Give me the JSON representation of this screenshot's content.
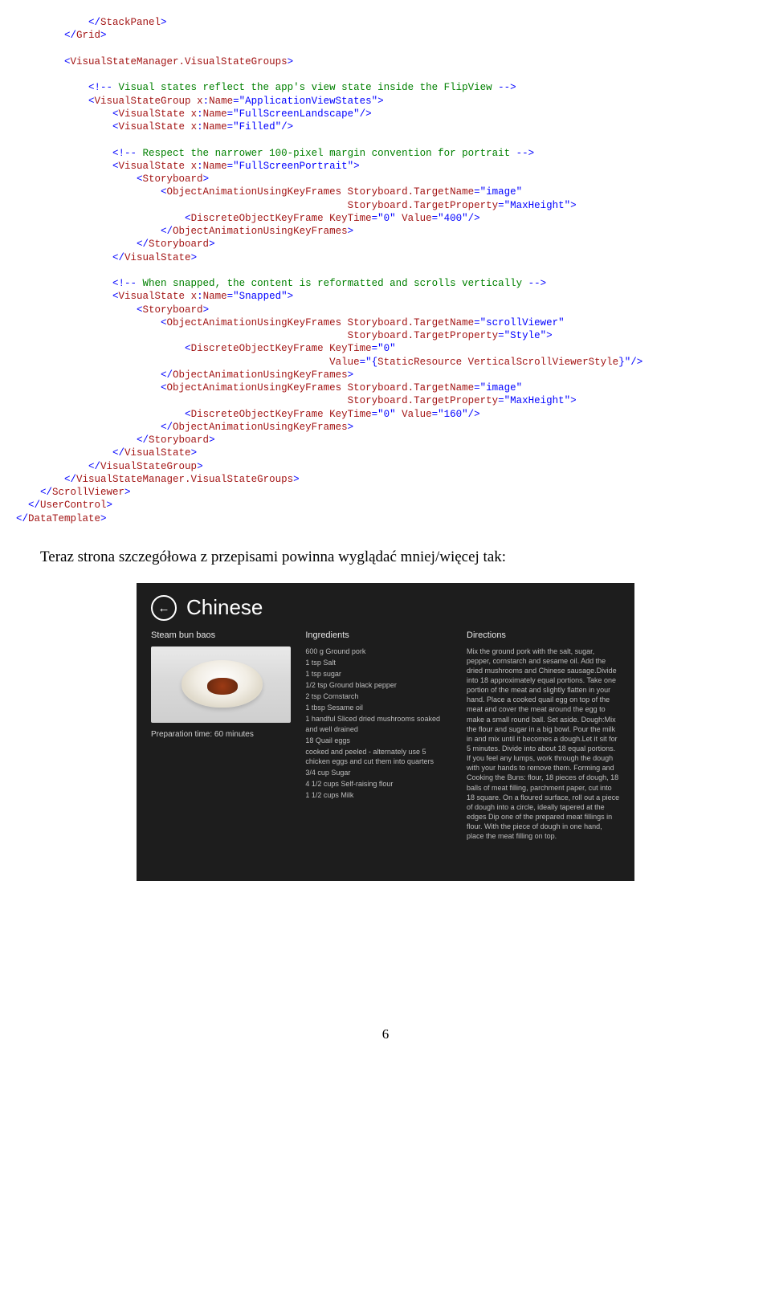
{
  "code_html": "            <span class=\"t-blue\">&lt;/</span><span class=\"t-maroon\">StackPanel</span><span class=\"t-blue\">&gt;</span>\n        <span class=\"t-blue\">&lt;/</span><span class=\"t-maroon\">Grid</span><span class=\"t-blue\">&gt;</span>\n\n        <span class=\"t-blue\">&lt;</span><span class=\"t-maroon\">VisualStateManager.VisualStateGroups</span><span class=\"t-blue\">&gt;</span>\n\n            <span class=\"t-blue\">&lt;!--</span><span class=\"t-green\"> Visual states reflect the app's view state inside the FlipView </span><span class=\"t-blue\">--&gt;</span>\n            <span class=\"t-blue\">&lt;</span><span class=\"t-maroon\">VisualStateGroup</span> <span class=\"t-red\">x</span><span class=\"t-blue\">:</span><span class=\"t-red\">Name</span><span class=\"t-blue\">=\"ApplicationViewStates\"&gt;</span>\n                <span class=\"t-blue\">&lt;</span><span class=\"t-maroon\">VisualState</span> <span class=\"t-red\">x</span><span class=\"t-blue\">:</span><span class=\"t-red\">Name</span><span class=\"t-blue\">=\"FullScreenLandscape\"/&gt;</span>\n                <span class=\"t-blue\">&lt;</span><span class=\"t-maroon\">VisualState</span> <span class=\"t-red\">x</span><span class=\"t-blue\">:</span><span class=\"t-red\">Name</span><span class=\"t-blue\">=\"Filled\"/&gt;</span>\n\n                <span class=\"t-blue\">&lt;!--</span><span class=\"t-green\"> Respect the narrower 100-pixel margin convention for portrait </span><span class=\"t-blue\">--&gt;</span>\n                <span class=\"t-blue\">&lt;</span><span class=\"t-maroon\">VisualState</span> <span class=\"t-red\">x</span><span class=\"t-blue\">:</span><span class=\"t-red\">Name</span><span class=\"t-blue\">=\"FullScreenPortrait\"&gt;</span>\n                    <span class=\"t-blue\">&lt;</span><span class=\"t-maroon\">Storyboard</span><span class=\"t-blue\">&gt;</span>\n                        <span class=\"t-blue\">&lt;</span><span class=\"t-maroon\">ObjectAnimationUsingKeyFrames</span> <span class=\"t-red\">Storyboard.TargetName</span><span class=\"t-blue\">=\"image\"</span>\n                                                       <span class=\"t-red\">Storyboard.TargetProperty</span><span class=\"t-blue\">=\"MaxHeight\"&gt;</span>\n                            <span class=\"t-blue\">&lt;</span><span class=\"t-maroon\">DiscreteObjectKeyFrame</span> <span class=\"t-red\">KeyTime</span><span class=\"t-blue\">=\"0\"</span> <span class=\"t-red\">Value</span><span class=\"t-blue\">=\"400\"/&gt;</span>\n                        <span class=\"t-blue\">&lt;/</span><span class=\"t-maroon\">ObjectAnimationUsingKeyFrames</span><span class=\"t-blue\">&gt;</span>\n                    <span class=\"t-blue\">&lt;/</span><span class=\"t-maroon\">Storyboard</span><span class=\"t-blue\">&gt;</span>\n                <span class=\"t-blue\">&lt;/</span><span class=\"t-maroon\">VisualState</span><span class=\"t-blue\">&gt;</span>\n\n                <span class=\"t-blue\">&lt;!--</span><span class=\"t-green\"> When snapped, the content is reformatted and scrolls vertically </span><span class=\"t-blue\">--&gt;</span>\n                <span class=\"t-blue\">&lt;</span><span class=\"t-maroon\">VisualState</span> <span class=\"t-red\">x</span><span class=\"t-blue\">:</span><span class=\"t-red\">Name</span><span class=\"t-blue\">=\"Snapped\"&gt;</span>\n                    <span class=\"t-blue\">&lt;</span><span class=\"t-maroon\">Storyboard</span><span class=\"t-blue\">&gt;</span>\n                        <span class=\"t-blue\">&lt;</span><span class=\"t-maroon\">ObjectAnimationUsingKeyFrames</span> <span class=\"t-red\">Storyboard.TargetName</span><span class=\"t-blue\">=\"scrollViewer\"</span>\n                                                       <span class=\"t-red\">Storyboard.TargetProperty</span><span class=\"t-blue\">=\"Style\"&gt;</span>\n                            <span class=\"t-blue\">&lt;</span><span class=\"t-maroon\">DiscreteObjectKeyFrame</span> <span class=\"t-red\">KeyTime</span><span class=\"t-blue\">=\"0\"</span>\n                                                    <span class=\"t-red\">Value</span><span class=\"t-blue\">=\"{</span><span class=\"t-maroon\">StaticResource</span> <span class=\"t-red\">VerticalScrollViewerStyle</span><span class=\"t-blue\">}\"/&gt;</span>\n                        <span class=\"t-blue\">&lt;/</span><span class=\"t-maroon\">ObjectAnimationUsingKeyFrames</span><span class=\"t-blue\">&gt;</span>\n                        <span class=\"t-blue\">&lt;</span><span class=\"t-maroon\">ObjectAnimationUsingKeyFrames</span> <span class=\"t-red\">Storyboard.TargetName</span><span class=\"t-blue\">=\"image\"</span>\n                                                       <span class=\"t-red\">Storyboard.TargetProperty</span><span class=\"t-blue\">=\"MaxHeight\"&gt;</span>\n                            <span class=\"t-blue\">&lt;</span><span class=\"t-maroon\">DiscreteObjectKeyFrame</span> <span class=\"t-red\">KeyTime</span><span class=\"t-blue\">=\"0\"</span> <span class=\"t-red\">Value</span><span class=\"t-blue\">=\"160\"/&gt;</span>\n                        <span class=\"t-blue\">&lt;/</span><span class=\"t-maroon\">ObjectAnimationUsingKeyFrames</span><span class=\"t-blue\">&gt;</span>\n                    <span class=\"t-blue\">&lt;/</span><span class=\"t-maroon\">Storyboard</span><span class=\"t-blue\">&gt;</span>\n                <span class=\"t-blue\">&lt;/</span><span class=\"t-maroon\">VisualState</span><span class=\"t-blue\">&gt;</span>\n            <span class=\"t-blue\">&lt;/</span><span class=\"t-maroon\">VisualStateGroup</span><span class=\"t-blue\">&gt;</span>\n        <span class=\"t-blue\">&lt;/</span><span class=\"t-maroon\">VisualStateManager.VisualStateGroups</span><span class=\"t-blue\">&gt;</span>\n    <span class=\"t-blue\">&lt;/</span><span class=\"t-maroon\">ScrollViewer</span><span class=\"t-blue\">&gt;</span>\n  <span class=\"t-blue\">&lt;/</span><span class=\"t-maroon\">UserControl</span><span class=\"t-blue\">&gt;</span>\n<span class=\"t-blue\">&lt;/</span><span class=\"t-maroon\">DataTemplate</span><span class=\"t-blue\">&gt;</span>",
  "prose": "Teraz strona szczegółowa z przepisami powinna wyglądać mniej/więcej tak:",
  "pagenum": "6",
  "ss": {
    "title": "Chinese",
    "back_glyph": "←",
    "col1": {
      "heading": "Steam bun baos",
      "prep": "Preparation time: 60 minutes"
    },
    "col2": {
      "heading": "Ingredients",
      "items": [
        "600 g Ground pork",
        "1 tsp Salt",
        "1 tsp sugar",
        "1/2 tsp Ground black pepper",
        "2 tsp Cornstarch",
        "1 tbsp Sesame oil",
        "1 handful Sliced dried mushrooms soaked and well drained",
        "18 Quail eggs",
        "cooked and peeled - alternately use 5 chicken eggs and cut them into quarters",
        "3/4 cup Sugar",
        "4 1/2 cups Self-raising flour",
        "1 1/2 cups Milk"
      ]
    },
    "col3": {
      "heading": "Directions",
      "text": "Mix the ground pork with the salt, sugar, pepper, cornstarch and sesame oil. Add the dried mushrooms and Chinese sausage.Divide into 18 approximately equal portions. Take one portion of the meat and slightly flatten in your hand. Place a cooked quail egg on top of the meat and cover the meat around the egg to make a small round ball. Set aside. Dough:Mix the flour and sugar in a big bowl. Pour the milk in and mix until it becomes a dough.Let it sit for 5 minutes. Divide into about 18 equal portions. If you feel any lumps, work through the dough with your hands to remove them. Forming and Cooking the Buns: flour, 18 pieces of dough, 18 balls of meat filling,  parchment paper, cut into 18 square. On a floured surface, roll out a piece of dough into a circle, ideally tapered at the edges Dip one of the prepared meat fillings in flour. With the piece of dough in one hand, place the meat filling on top."
    }
  }
}
